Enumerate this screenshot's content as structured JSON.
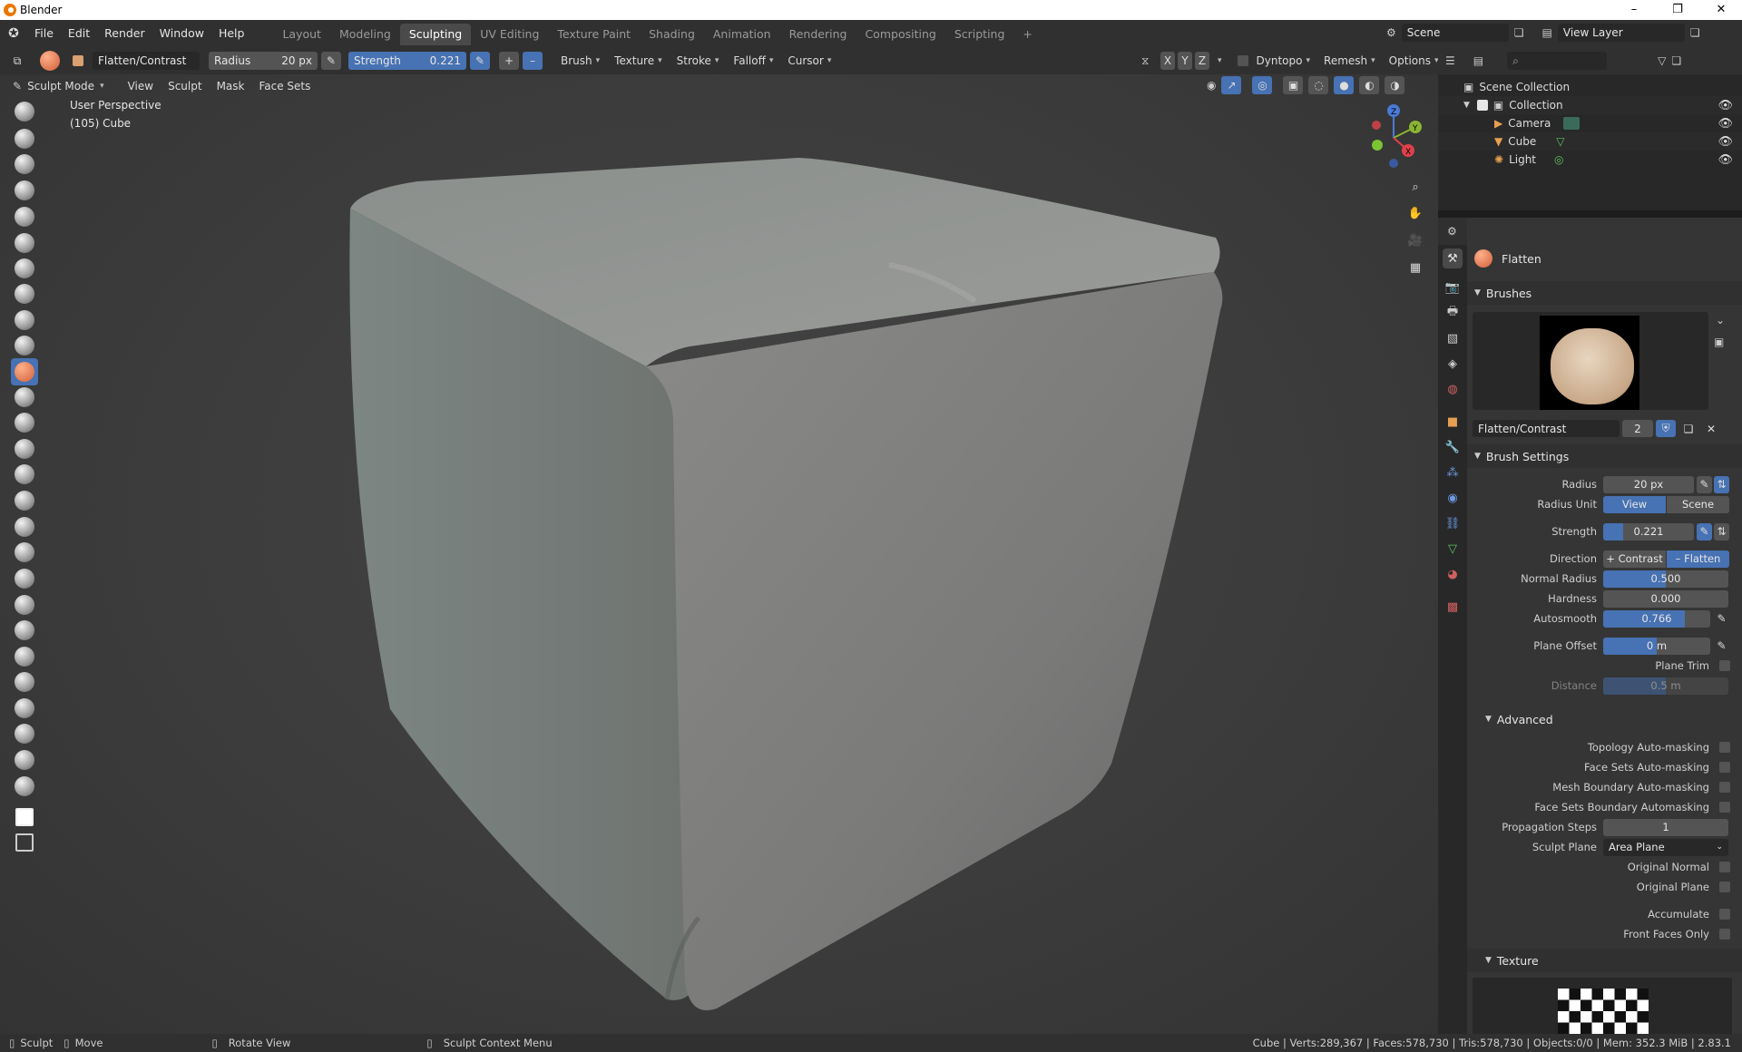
{
  "window": {
    "title": "Blender"
  },
  "menu": {
    "items": [
      "File",
      "Edit",
      "Render",
      "Window",
      "Help"
    ]
  },
  "workspaces": {
    "tabs": [
      "Layout",
      "Modeling",
      "Sculpting",
      "UV Editing",
      "Texture Paint",
      "Shading",
      "Animation",
      "Rendering",
      "Compositing",
      "Scripting"
    ],
    "active": "Sculpting",
    "add_label": "+"
  },
  "scene": {
    "label": "Scene",
    "view_layer": "View Layer"
  },
  "tool_header": {
    "brush_name": "Flatten/Contrast",
    "radius_label": "Radius",
    "radius_value": "20 px",
    "strength_label": "Strength",
    "strength_value": "0.221",
    "plus_label": "+",
    "minus_label": "–",
    "menus": [
      "Brush",
      "Texture",
      "Stroke",
      "Falloff",
      "Cursor"
    ],
    "symmetry": [
      "X",
      "Y",
      "Z"
    ],
    "dyntopo_label": "Dyntopo",
    "remesh_label": "Remesh",
    "options_label": "Options"
  },
  "mode_header": {
    "mode_label": "Sculpt Mode",
    "menus": [
      "View",
      "Sculpt",
      "Mask",
      "Face Sets"
    ]
  },
  "viewport": {
    "perspective_label": "User Perspective",
    "object_label": "(105) Cube"
  },
  "gizmo": {
    "x": "X",
    "y": "Y",
    "z": "Z"
  },
  "outliner": {
    "root": "Scene Collection",
    "collection": "Collection",
    "items": [
      {
        "name": "Camera",
        "icon": "camera-icon"
      },
      {
        "name": "Cube",
        "icon": "mesh-icon"
      },
      {
        "name": "Light",
        "icon": "light-icon"
      }
    ]
  },
  "properties": {
    "brush_header": "Flatten",
    "brushes_section": "Brushes",
    "brush_datablock": "Flatten/Contrast",
    "brush_users": "2",
    "brush_settings_section": "Brush Settings",
    "radius": {
      "label": "Radius",
      "value": "20 px"
    },
    "radius_unit": {
      "label": "Radius Unit",
      "options": [
        "View",
        "Scene"
      ],
      "selected": "View"
    },
    "strength": {
      "label": "Strength",
      "value": "0.221",
      "fraction": 0.221
    },
    "direction": {
      "label": "Direction",
      "options": [
        "+ Contrast",
        "– Flatten"
      ],
      "selected": "– Flatten"
    },
    "normal_radius": {
      "label": "Normal Radius",
      "value": "0.500",
      "fraction": 0.5
    },
    "hardness": {
      "label": "Hardness",
      "value": "0.000",
      "fraction": 0.0
    },
    "autosmooth": {
      "label": "Autosmooth",
      "value": "0.766",
      "fraction": 0.766
    },
    "plane_offset": {
      "label": "Plane Offset",
      "value": "0 m",
      "fraction": 0.5
    },
    "plane_trim": {
      "label": "Plane Trim"
    },
    "distance": {
      "label": "Distance",
      "value": "0.5 m",
      "fraction": 0.5
    },
    "advanced_section": "Advanced",
    "checkboxes_a": [
      "Topology Auto-masking",
      "Face Sets Auto-masking",
      "Mesh Boundary Auto-masking",
      "Face Sets Boundary Automasking"
    ],
    "propagation_steps": {
      "label": "Propagation Steps",
      "value": "1"
    },
    "sculpt_plane": {
      "label": "Sculpt Plane",
      "value": "Area Plane"
    },
    "checkboxes_b": [
      "Original Normal",
      "Original Plane"
    ],
    "checkboxes_c": [
      "Accumulate",
      "Front Faces Only"
    ],
    "texture_section": "Texture"
  },
  "statusbar": {
    "sculpt": "Sculpt",
    "move": "Move",
    "rotate": "Rotate View",
    "context": "Sculpt Context Menu",
    "stats": "Cube | Verts:289,367 | Faces:578,730 | Tris:578,730 | Objects:0/0 | Mem: 352.3 MiB | 2.83.1"
  },
  "colors": {
    "accent": "#4772b3",
    "header": "#303030",
    "panel": "#353535",
    "viewport": "#3d3d3d"
  }
}
